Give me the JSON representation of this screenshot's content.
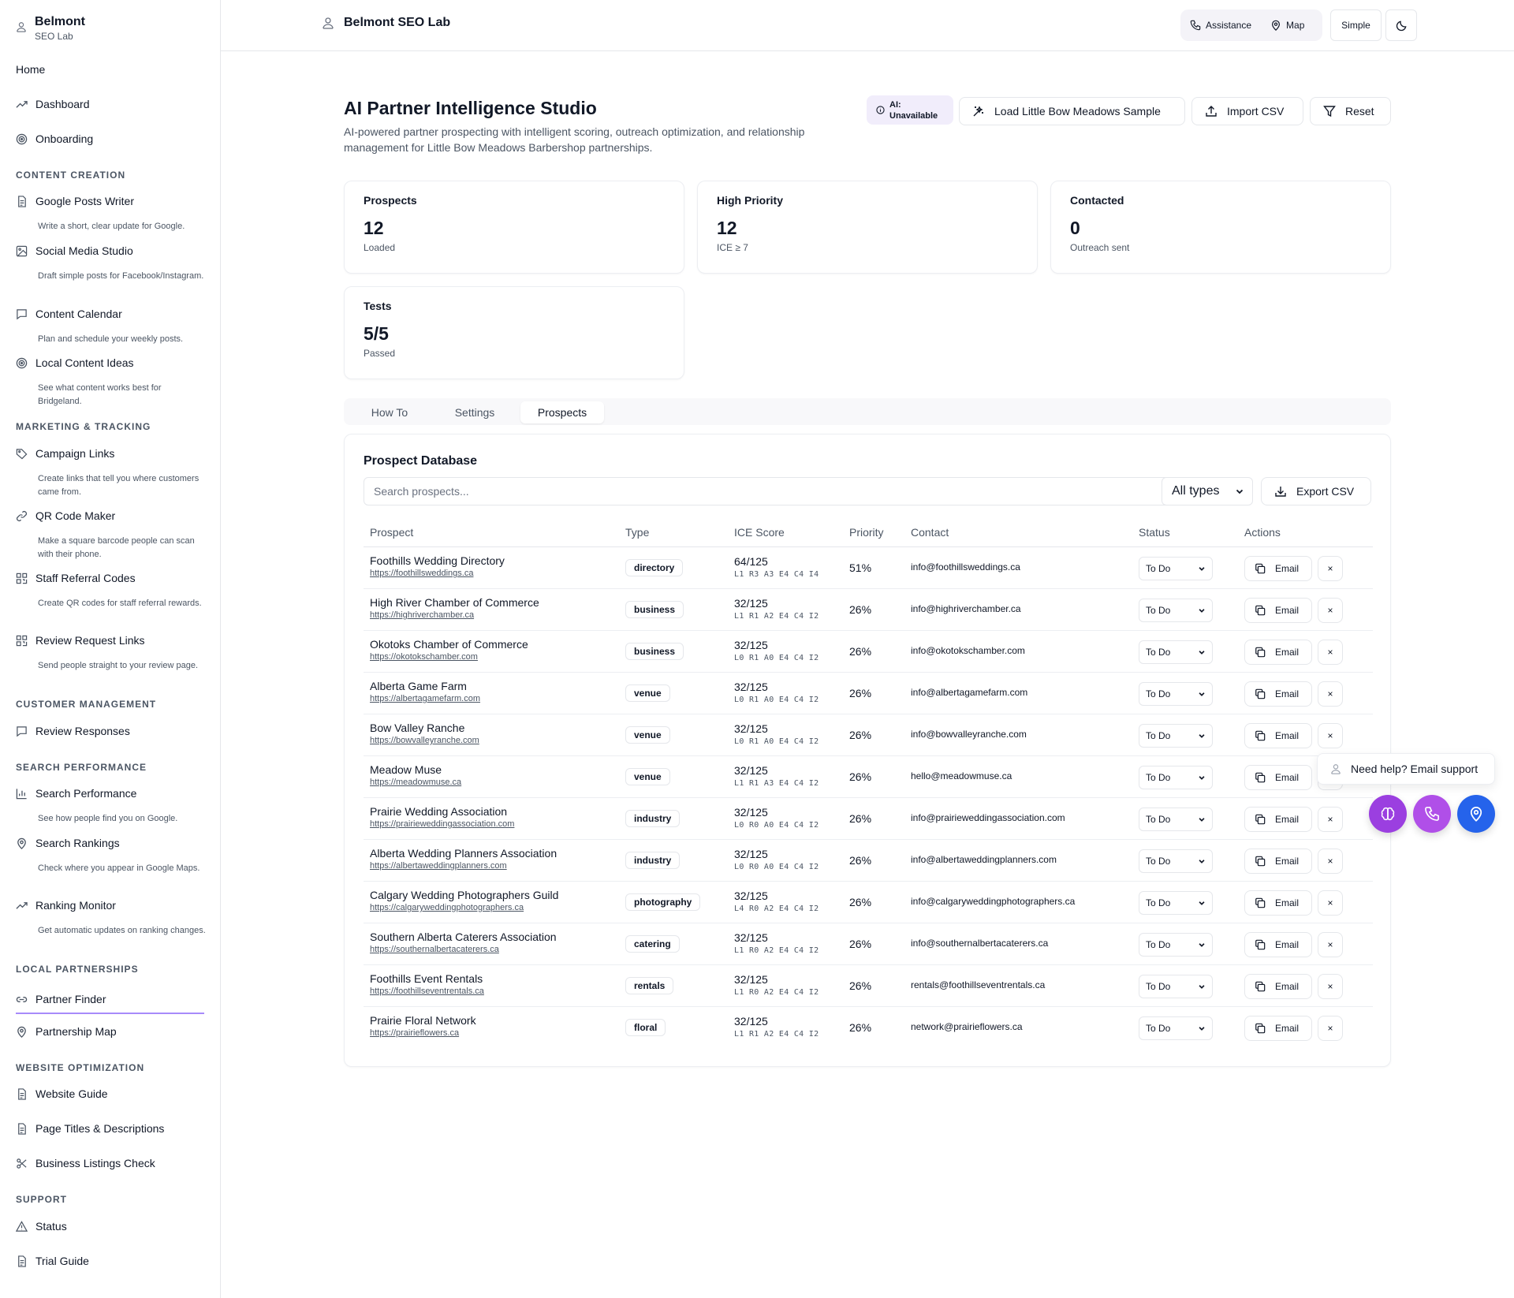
{
  "brand": {
    "name": "Belmont",
    "sub": "SEO Lab"
  },
  "sidebar": {
    "top_items": [
      {
        "label": "Home"
      },
      {
        "label": "Dashboard"
      },
      {
        "label": "Onboarding"
      }
    ],
    "sections": [
      {
        "title": "CONTENT CREATION",
        "items": [
          {
            "label": "Google Posts Writer",
            "desc": "Write a short, clear update for Google."
          },
          {
            "label": "Social Media Studio",
            "desc": "Draft simple posts for Facebook/Instagram."
          },
          {
            "label": "Content Calendar",
            "desc": "Plan and schedule your weekly posts."
          },
          {
            "label": "Local Content Ideas",
            "desc": "See what content works best for Bridgeland."
          }
        ]
      },
      {
        "title": "MARKETING & TRACKING",
        "items": [
          {
            "label": "Campaign Links",
            "desc": "Create links that tell you where customers came from."
          },
          {
            "label": "QR Code Maker",
            "desc": "Make a square barcode people can scan with their phone."
          },
          {
            "label": "Staff Referral Codes",
            "desc": "Create QR codes for staff referral rewards."
          },
          {
            "label": "Review Request Links",
            "desc": "Send people straight to your review page."
          }
        ]
      },
      {
        "title": "CUSTOMER MANAGEMENT",
        "items": [
          {
            "label": "Review Responses"
          }
        ]
      },
      {
        "title": "SEARCH PERFORMANCE",
        "items": [
          {
            "label": "Search Performance",
            "desc": "See how people find you on Google."
          },
          {
            "label": "Search Rankings",
            "desc": "Check where you appear in Google Maps."
          },
          {
            "label": "Ranking Monitor",
            "desc": "Get automatic updates on ranking changes."
          }
        ]
      },
      {
        "title": "LOCAL PARTNERSHIPS",
        "items": [
          {
            "label": "Partner Finder"
          },
          {
            "label": "Partnership Map"
          }
        ]
      },
      {
        "title": "WEBSITE OPTIMIZATION",
        "items": [
          {
            "label": "Website Guide"
          },
          {
            "label": "Page Titles & Descriptions"
          },
          {
            "label": "Business Listings Check"
          }
        ]
      },
      {
        "title": "SUPPORT",
        "items": [
          {
            "label": "Status"
          },
          {
            "label": "Trial Guide"
          }
        ]
      }
    ]
  },
  "topbar": {
    "title": "Belmont SEO Lab",
    "assistance": "Assistance",
    "map": "Map",
    "simple": "Simple"
  },
  "header": {
    "title": "AI Partner Intelligence Studio",
    "subtitle": "AI-powered partner prospecting with intelligent scoring, outreach optimization, and relationship management for Little Bow Meadows Barbershop partnerships.",
    "ai_badge_line1": "AI:",
    "ai_badge_line2": "Unavailable",
    "load_sample": "Load Little Bow Meadows Sample",
    "import_csv": "Import CSV",
    "reset": "Reset"
  },
  "stats": [
    {
      "label": "Prospects",
      "value": "12",
      "sub": "Loaded"
    },
    {
      "label": "High Priority",
      "value": "12",
      "sub": "ICE ≥ 7"
    },
    {
      "label": "Contacted",
      "value": "0",
      "sub": "Outreach sent"
    },
    {
      "label": "Tests",
      "value": "5/5",
      "sub": "Passed"
    }
  ],
  "tabs": [
    {
      "label": "How To"
    },
    {
      "label": "Settings"
    },
    {
      "label": "Prospects"
    }
  ],
  "prospects": {
    "title": "Prospect Database",
    "search_placeholder": "Search prospects...",
    "type_filter": "All types",
    "export_label": "Export CSV",
    "columns": [
      "Prospect",
      "Type",
      "ICE Score",
      "Priority",
      "Contact",
      "Status",
      "Actions"
    ],
    "email_label": "Email",
    "close_label": "×",
    "rows": [
      {
        "name": "Foothills Wedding Directory",
        "url": "https://foothillsweddings.ca",
        "type": "directory",
        "score": "64/125",
        "breakdown": "L1 R3 A3 E4 C4 I4",
        "priority": "51%",
        "contact": "info@foothillsweddings.ca",
        "status": "To Do"
      },
      {
        "name": "High River Chamber of Commerce",
        "url": "https://highriverchamber.ca",
        "type": "business",
        "score": "32/125",
        "breakdown": "L1 R1 A2 E4 C4 I2",
        "priority": "26%",
        "contact": "info@highriverchamber.ca",
        "status": "To Do"
      },
      {
        "name": "Okotoks Chamber of Commerce",
        "url": "https://okotokschamber.com",
        "type": "business",
        "score": "32/125",
        "breakdown": "L0 R1 A0 E4 C4 I2",
        "priority": "26%",
        "contact": "info@okotokschamber.com",
        "status": "To Do"
      },
      {
        "name": "Alberta Game Farm",
        "url": "https://albertagamefarm.com",
        "type": "venue",
        "score": "32/125",
        "breakdown": "L0 R1 A0 E4 C4 I2",
        "priority": "26%",
        "contact": "info@albertagamefarm.com",
        "status": "To Do"
      },
      {
        "name": "Bow Valley Ranche",
        "url": "https://bowvalleyranche.com",
        "type": "venue",
        "score": "32/125",
        "breakdown": "L0 R1 A0 E4 C4 I2",
        "priority": "26%",
        "contact": "info@bowvalleyranche.com",
        "status": "To Do"
      },
      {
        "name": "Meadow Muse",
        "url": "https://meadowmuse.ca",
        "type": "venue",
        "score": "32/125",
        "breakdown": "L1 R1 A3 E4 C4 I2",
        "priority": "26%",
        "contact": "hello@meadowmuse.ca",
        "status": "To Do"
      },
      {
        "name": "Prairie Wedding Association",
        "url": "https://prairieweddingassociation.com",
        "type": "industry",
        "score": "32/125",
        "breakdown": "L0 R0 A0 E4 C4 I2",
        "priority": "26%",
        "contact": "info@prairieweddingassociation.com",
        "status": "To Do"
      },
      {
        "name": "Alberta Wedding Planners Association",
        "url": "https://albertaweddingplanners.com",
        "type": "industry",
        "score": "32/125",
        "breakdown": "L0 R0 A0 E4 C4 I2",
        "priority": "26%",
        "contact": "info@albertaweddingplanners.com",
        "status": "To Do"
      },
      {
        "name": "Calgary Wedding Photographers Guild",
        "url": "https://calgaryweddingphotographers.ca",
        "type": "photography",
        "score": "32/125",
        "breakdown": "L4 R0 A2 E4 C4 I2",
        "priority": "26%",
        "contact": "info@calgaryweddingphotographers.ca",
        "status": "To Do"
      },
      {
        "name": "Southern Alberta Caterers Association",
        "url": "https://southernalbertacaterers.ca",
        "type": "catering",
        "score": "32/125",
        "breakdown": "L1 R0 A2 E4 C4 I2",
        "priority": "26%",
        "contact": "info@southernalbertacaterers.ca",
        "status": "To Do"
      },
      {
        "name": "Foothills Event Rentals",
        "url": "https://foothillseventrentals.ca",
        "type": "rentals",
        "score": "32/125",
        "breakdown": "L1 R0 A2 E4 C4 I2",
        "priority": "26%",
        "contact": "rentals@foothillseventrentals.ca",
        "status": "To Do"
      },
      {
        "name": "Prairie Floral Network",
        "url": "https://prairieflowers.ca",
        "type": "floral",
        "score": "32/125",
        "breakdown": "L1 R1 A2 E4 C4 I2",
        "priority": "26%",
        "contact": "network@prairieflowers.ca",
        "status": "To Do"
      }
    ]
  },
  "help": {
    "tip": "Need help? Email support"
  },
  "colors": {
    "accent": "#9b3fe0",
    "fab_blue": "#2563eb",
    "active_underline": "#a78bfa"
  }
}
